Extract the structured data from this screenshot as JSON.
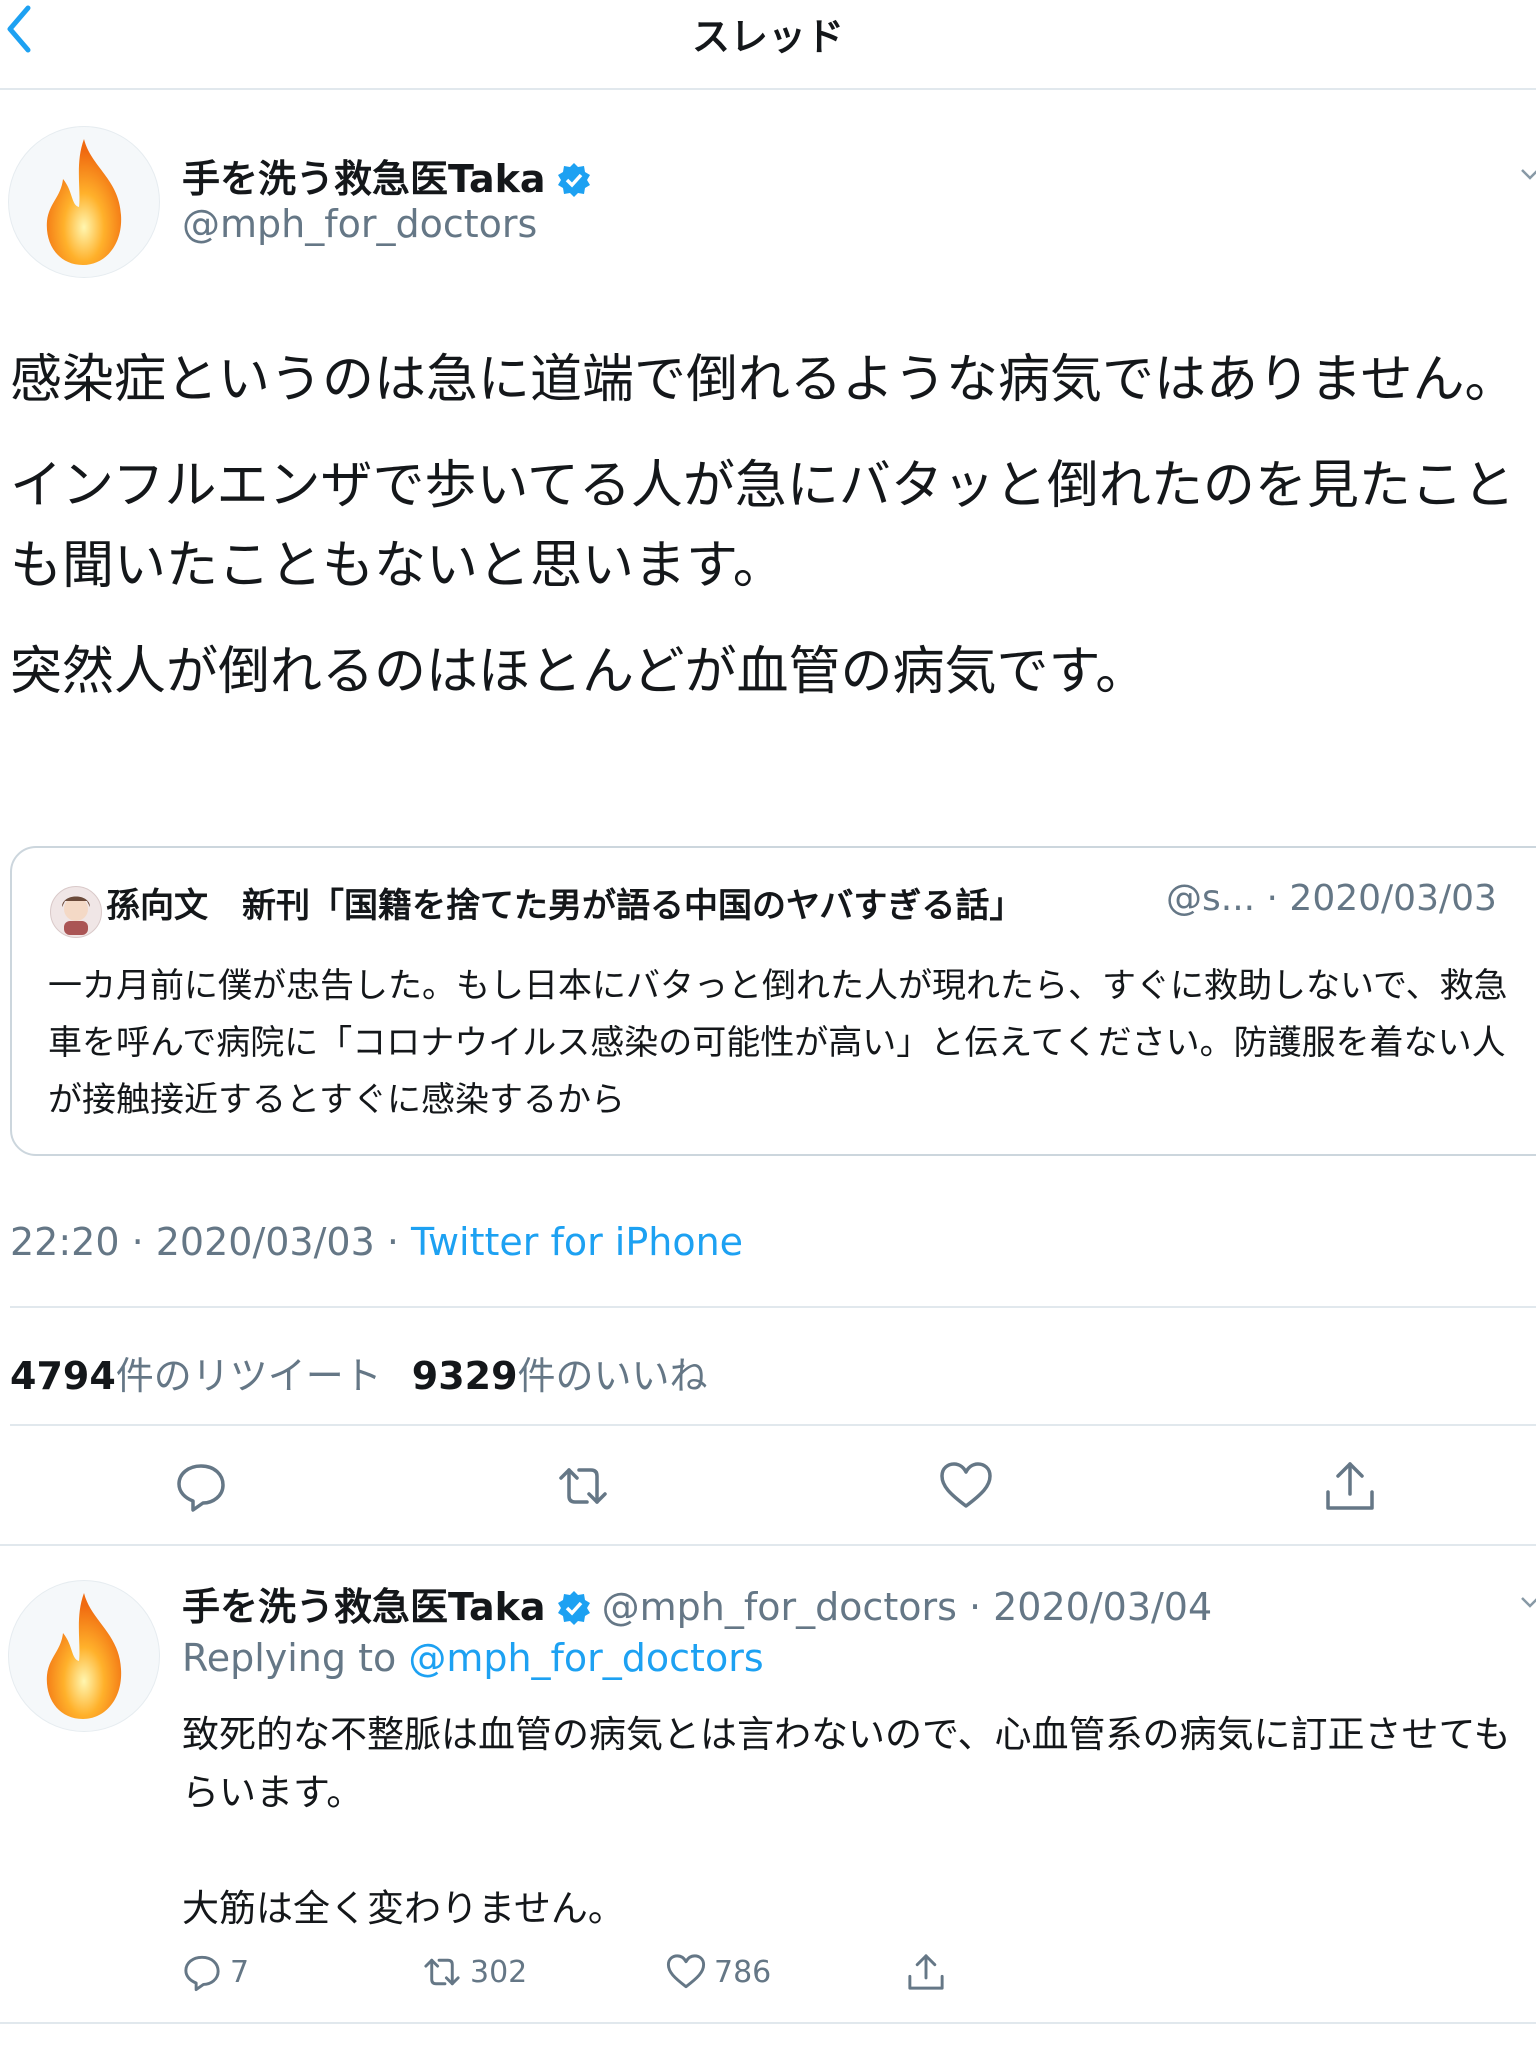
{
  "header": {
    "title": "スレッド"
  },
  "tweet": {
    "author_name": "手を洗う救急医Taka",
    "handle": "@mph_for_doctors",
    "body": [
      "感染症というのは急に道端で倒れるような病気ではありません。",
      "インフルエンザで歩いてる人が急にバタッと倒れたのを見たことも聞いたこともないと思います。",
      "突然人が倒れるのはほとんどが血管の病気です。"
    ],
    "quote": {
      "author_name": "孫向文　新刊「国籍を捨てた男が語る中国のヤバすぎる話」",
      "handle_date": "@s... · 2020/03/03",
      "text": "一カ月前に僕が忠告した。もし日本にバタっと倒れた人が現れたら、すぐに救助しないで、救急車を呼んで病院に「コロナウイルス感染の可能性が高い」と伝えてください。防護服を着ない人が接触接近するとすぐに感染するから"
    },
    "timestamp": "22:20 · 2020/03/03 · ",
    "source": "Twitter for iPhone",
    "retweet_count": "4794",
    "retweet_label": "件のリツイート",
    "like_count": "9329",
    "like_label": "件のいいね"
  },
  "reply": {
    "author_name": "手を洗う救急医Taka",
    "meta": "@mph_for_doctors · 2020/03/04",
    "replying_label": "Replying to ",
    "replying_handle": "@mph_for_doctors",
    "body": [
      "致死的な不整脈は血管の病気とは言わないので、心血管系の病気に訂正させてもらいます。",
      "",
      "大筋は全く変わりません。"
    ],
    "reply_count": "7",
    "retweet_count": "302",
    "like_count": "786"
  },
  "icons": {
    "back": "chevron-left-icon",
    "verified": "verified-badge-icon",
    "reply": "reply-icon",
    "retweet": "retweet-icon",
    "like": "heart-icon",
    "share": "share-icon"
  },
  "colors": {
    "accent": "#1da1f2",
    "secondary_text": "#657786",
    "divider": "#e1e8ed"
  }
}
